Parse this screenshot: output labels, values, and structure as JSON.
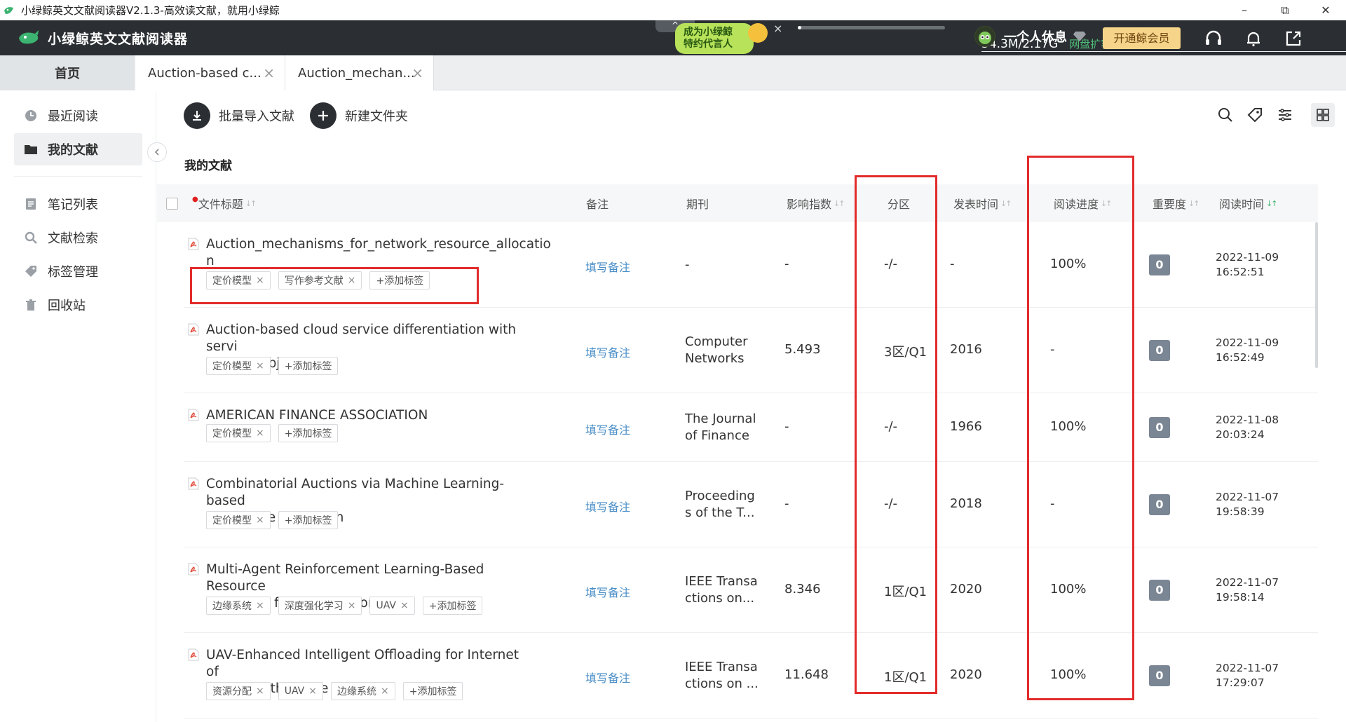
{
  "window": {
    "title": "小绿鲸英文文献阅读器V2.1.3-高效读文献，就用小绿鲸",
    "minimize_glyph": "–",
    "restore_glyph": "⧉",
    "close_glyph": "✕"
  },
  "header": {
    "brand_name": "小绿鲸英文文献阅读器",
    "promo_collapse": "^",
    "promo_line1": "成为小绿鲸",
    "promo_line2": "特约代言人",
    "promo_close": "×",
    "storage_used": "54.3M/2.17G",
    "storage_fraction": 0.025,
    "storage_expand": "网盘扩容>",
    "username": "一个人休息",
    "vip_button": "开通鲸会员",
    "icons": [
      "headset-icon",
      "bell-icon",
      "share-out-icon"
    ]
  },
  "tabs": [
    {
      "label": "首页"
    },
    {
      "label": "Auction-based c...",
      "close": "×"
    },
    {
      "label": "Auction_mechan...",
      "close": "×"
    }
  ],
  "sidebar": {
    "items": [
      {
        "label": "最近阅读",
        "icon": "clock-icon"
      },
      {
        "label": "我的文献",
        "icon": "folder-icon"
      },
      {
        "label": "笔记列表",
        "icon": "note-icon"
      },
      {
        "label": "文献检索",
        "icon": "search-icon"
      },
      {
        "label": "标签管理",
        "icon": "tag-icon"
      },
      {
        "label": "回收站",
        "icon": "trash-icon"
      }
    ]
  },
  "toolbar": {
    "import_label": "批量导入文献",
    "new_folder_label": "新建文件夹",
    "right_icons": [
      "search-icon",
      "tag-icon",
      "filter-icon",
      "grid-view-icon"
    ]
  },
  "section_title": "我的文献",
  "table": {
    "columns": {
      "title": "文件标题",
      "note": "备注",
      "journal": "期刊",
      "impact": "影响指数",
      "zone": "分区",
      "pub_time": "发表时间",
      "progress": "阅读进度",
      "importance": "重要度",
      "read_time": "阅读时间"
    },
    "note_placeholder": "填写备注",
    "add_tag_label": "+添加标签",
    "rows": [
      {
        "title": "Auction_mechanisms_for_network_resource_allocation",
        "title_line1": "Auction_mechanisms_for_network_resource_allocatio",
        "title_line2": "n",
        "tags": [
          "定价模型",
          "写作参考文献"
        ],
        "journal_l1": "-",
        "journal_l2": "",
        "impact": "-",
        "zone": "-/-",
        "year": "-",
        "progress": "100%",
        "importance": "0",
        "read_date": "2022-11-09",
        "read_clock": "16:52:51"
      },
      {
        "title": "Auction-based cloud service differentiation with service level objectives",
        "title_line1": "Auction-based cloud service differentiation with servi",
        "title_line2": "ce level objectives",
        "tags": [
          "定价模型"
        ],
        "journal_l1": "Computer",
        "journal_l2": "Networks",
        "impact": "5.493",
        "zone": "3区/Q1",
        "year": "2016",
        "progress": "-",
        "importance": "0",
        "read_date": "2022-11-09",
        "read_clock": "16:52:49"
      },
      {
        "title": "AMERICAN FINANCE ASSOCIATION",
        "title_line1": "AMERICAN FINANCE ASSOCIATION",
        "title_line2": "",
        "tags": [
          "定价模型"
        ],
        "journal_l1": "The Journal",
        "journal_l2": "of Finance",
        "impact": "-",
        "zone": "-/-",
        "year": "1966",
        "progress": "100%",
        "importance": "0",
        "read_date": "2022-11-08",
        "read_clock": "20:03:24"
      },
      {
        "title": "Combinatorial Auctions via Machine Learning-based Preference Elicitation",
        "title_line1": "Combinatorial Auctions via Machine Learning-based",
        "title_line2": "Preference Elicitation",
        "tags": [
          "定价模型"
        ],
        "journal_l1": "Proceeding",
        "journal_l2": "s of the T...",
        "impact": "-",
        "zone": "-/-",
        "year": "2018",
        "progress": "-",
        "importance": "0",
        "read_date": "2022-11-07",
        "read_clock": "19:58:39"
      },
      {
        "title": "Multi-Agent Reinforcement Learning-Based Resource Allocation for UAV Networks",
        "title_line1": "Multi-Agent Reinforcement Learning-Based Resource",
        "title_line2": "Allocation for UAV Networks",
        "tags": [
          "边缘系统",
          "深度强化学习",
          "UAV"
        ],
        "journal_l1": "IEEE Transa",
        "journal_l2": "ctions on...",
        "impact": "8.346",
        "zone": "1区/Q1",
        "year": "2020",
        "progress": "100%",
        "importance": "0",
        "read_date": "2022-11-07",
        "read_clock": "19:58:14"
      },
      {
        "title": "UAV-Enhanced Intelligent Offloading for Internet of Things at the Edge",
        "title_line1": "UAV-Enhanced Intelligent Offloading for Internet of",
        "title_line2": "Things at the Edge",
        "tags": [
          "资源分配",
          "UAV",
          "边缘系统"
        ],
        "journal_l1": "IEEE Transa",
        "journal_l2": "ctions on ...",
        "impact": "11.648",
        "zone": "1区/Q1",
        "year": "2020",
        "progress": "100%",
        "importance": "0",
        "read_date": "2022-11-07",
        "read_clock": "17:29:07"
      }
    ]
  },
  "colors": {
    "header_bg": "#2b2f33",
    "accent_green": "#4fc07a",
    "link_blue": "#4a8ec7",
    "highlight_red": "#e22b2b",
    "vip_gold": "#f6d58a"
  }
}
